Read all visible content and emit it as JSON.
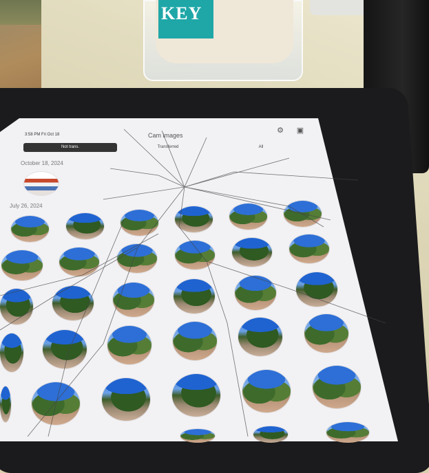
{
  "scene": {
    "mug_text": "KEY",
    "device_icon": "camera-icon"
  },
  "statusbar": {
    "time": "3:58 PM Fri Oct 18"
  },
  "navbar": {
    "title": "Cam images",
    "icons": [
      "gear-icon",
      "folder-icon"
    ]
  },
  "filter": {
    "options": [
      "Not trans.",
      "Transferred",
      "All"
    ],
    "selected": "Not trans."
  },
  "sections": [
    {
      "date": "October 18, 2024",
      "count": 1
    },
    {
      "date": "July 26, 2024",
      "count": 36
    }
  ],
  "colors": {
    "segment_active": "#333333",
    "background": "#f2f1f4"
  }
}
